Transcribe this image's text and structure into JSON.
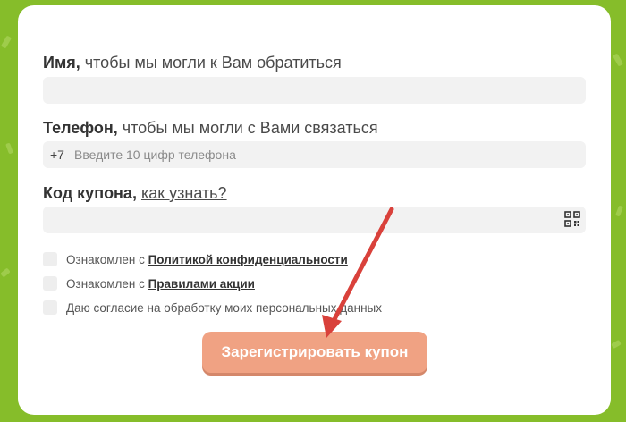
{
  "form": {
    "name_label_bold": "Имя,",
    "name_label_rest": " чтобы мы могли к Вам обратиться",
    "name_value": "",
    "phone_label_bold": "Телефон,",
    "phone_label_rest": " чтобы мы могли с Вами связаться",
    "phone_prefix": "+7",
    "phone_placeholder": "Введите 10 цифр телефона",
    "coupon_label_bold": "Код купона,",
    "coupon_link": "как узнать?",
    "coupon_value": ""
  },
  "consents": [
    {
      "prefix": "Ознакомлен с ",
      "link": "Политикой конфиденциальности",
      "checked": false
    },
    {
      "prefix": "Ознакомлен с ",
      "link": "Правилами акции",
      "checked": false
    },
    {
      "prefix": "Даю согласие на обработку моих персональных данных",
      "link": "",
      "checked": false
    }
  ],
  "submit_label": "Зарегистрировать купон",
  "icons": {
    "qr": "qr-code-icon"
  },
  "colors": {
    "background": "#86bd2a",
    "button": "#f0a283",
    "arrow": "#d9413b"
  }
}
